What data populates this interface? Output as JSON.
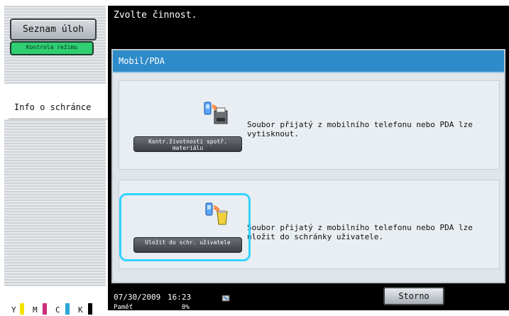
{
  "left": {
    "buttons": {
      "seznam_label": "Seznam úloh",
      "kontrola_label": "Kontrola režimu"
    },
    "info_label": "Info o schránce",
    "toner": {
      "items": [
        "Y",
        "M",
        "C",
        "K"
      ],
      "colors": [
        "#f2e200",
        "#cc2f7a",
        "#2fa6d8",
        "#000000"
      ]
    }
  },
  "header": {
    "prompt": "Zvolte činnost."
  },
  "panel": {
    "title": "Mobil/PDA",
    "section1": {
      "button_label": "Kontr.životnosti spotř. materiálu",
      "description": "Soubor přijatý z mobilního telefonu nebo PDA lze vytisknout."
    },
    "section2": {
      "button_label": "Uložit do schr. uživatele",
      "description": "Soubor přijatý z mobilního telefonu nebo PDA lze uložit do schránky uživatele."
    }
  },
  "footer": {
    "date": "07/30/2009",
    "time": "16:23",
    "memory_label": "Paměť",
    "memory_value": "0%",
    "storno_label": "Storno"
  }
}
